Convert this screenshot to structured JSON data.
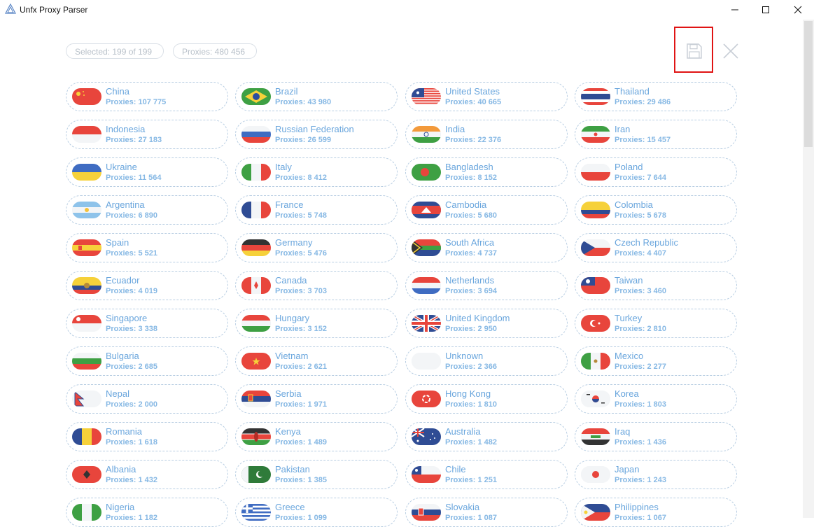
{
  "window": {
    "title": "Unfx Proxy Parser"
  },
  "toolbar": {
    "selected_text": "Selected: 199 of 199",
    "proxies_text": "Proxies: 480 456",
    "save_icon": "save-icon",
    "close_icon": "close-icon"
  },
  "countries": [
    {
      "name": "China",
      "count": "Proxies: 107 775",
      "flag": "cn"
    },
    {
      "name": "Brazil",
      "count": "Proxies: 43 980",
      "flag": "br"
    },
    {
      "name": "United States",
      "count": "Proxies: 40 665",
      "flag": "us"
    },
    {
      "name": "Thailand",
      "count": "Proxies: 29 486",
      "flag": "th"
    },
    {
      "name": "Indonesia",
      "count": "Proxies: 27 183",
      "flag": "id"
    },
    {
      "name": "Russian Federation",
      "count": "Proxies: 26 599",
      "flag": "ru"
    },
    {
      "name": "India",
      "count": "Proxies: 22 376",
      "flag": "in"
    },
    {
      "name": "Iran",
      "count": "Proxies: 15 457",
      "flag": "ir"
    },
    {
      "name": "Ukraine",
      "count": "Proxies: 11 564",
      "flag": "ua"
    },
    {
      "name": "Italy",
      "count": "Proxies: 8 412",
      "flag": "it"
    },
    {
      "name": "Bangladesh",
      "count": "Proxies: 8 152",
      "flag": "bd"
    },
    {
      "name": "Poland",
      "count": "Proxies: 7 644",
      "flag": "pl"
    },
    {
      "name": "Argentina",
      "count": "Proxies: 6 890",
      "flag": "ar"
    },
    {
      "name": "France",
      "count": "Proxies: 5 748",
      "flag": "fr"
    },
    {
      "name": "Cambodia",
      "count": "Proxies: 5 680",
      "flag": "kh"
    },
    {
      "name": "Colombia",
      "count": "Proxies: 5 678",
      "flag": "co"
    },
    {
      "name": "Spain",
      "count": "Proxies: 5 521",
      "flag": "es"
    },
    {
      "name": "Germany",
      "count": "Proxies: 5 476",
      "flag": "de"
    },
    {
      "name": "South Africa",
      "count": "Proxies: 4 737",
      "flag": "za"
    },
    {
      "name": "Czech Republic",
      "count": "Proxies: 4 407",
      "flag": "cz"
    },
    {
      "name": "Ecuador",
      "count": "Proxies: 4 019",
      "flag": "ec"
    },
    {
      "name": "Canada",
      "count": "Proxies: 3 703",
      "flag": "ca"
    },
    {
      "name": "Netherlands",
      "count": "Proxies: 3 694",
      "flag": "nl"
    },
    {
      "name": "Taiwan",
      "count": "Proxies: 3 460",
      "flag": "tw"
    },
    {
      "name": "Singapore",
      "count": "Proxies: 3 338",
      "flag": "sg"
    },
    {
      "name": "Hungary",
      "count": "Proxies: 3 152",
      "flag": "hu"
    },
    {
      "name": "United Kingdom",
      "count": "Proxies: 2 950",
      "flag": "gb"
    },
    {
      "name": "Turkey",
      "count": "Proxies: 2 810",
      "flag": "tr"
    },
    {
      "name": "Bulgaria",
      "count": "Proxies: 2 685",
      "flag": "bg"
    },
    {
      "name": "Vietnam",
      "count": "Proxies: 2 621",
      "flag": "vn"
    },
    {
      "name": "Unknown",
      "count": "Proxies: 2 366",
      "flag": "unknown"
    },
    {
      "name": "Mexico",
      "count": "Proxies: 2 277",
      "flag": "mx"
    },
    {
      "name": "Nepal",
      "count": "Proxies: 2 000",
      "flag": "np"
    },
    {
      "name": "Serbia",
      "count": "Proxies: 1 971",
      "flag": "rs"
    },
    {
      "name": "Hong Kong",
      "count": "Proxies: 1 810",
      "flag": "hk"
    },
    {
      "name": "Korea",
      "count": "Proxies: 1 803",
      "flag": "kr"
    },
    {
      "name": "Romania",
      "count": "Proxies: 1 618",
      "flag": "ro"
    },
    {
      "name": "Kenya",
      "count": "Proxies: 1 489",
      "flag": "ke"
    },
    {
      "name": "Australia",
      "count": "Proxies: 1 482",
      "flag": "au"
    },
    {
      "name": "Iraq",
      "count": "Proxies: 1 436",
      "flag": "iq"
    },
    {
      "name": "Albania",
      "count": "Proxies: 1 432",
      "flag": "al"
    },
    {
      "name": "Pakistan",
      "count": "Proxies: 1 385",
      "flag": "pk"
    },
    {
      "name": "Chile",
      "count": "Proxies: 1 251",
      "flag": "cl"
    },
    {
      "name": "Japan",
      "count": "Proxies: 1 243",
      "flag": "jp"
    },
    {
      "name": "Nigeria",
      "count": "Proxies: 1 182",
      "flag": "ng"
    },
    {
      "name": "Greece",
      "count": "Proxies: 1 099",
      "flag": "gr"
    },
    {
      "name": "Slovakia",
      "count": "Proxies: 1 087",
      "flag": "sk"
    },
    {
      "name": "Philippines",
      "count": "Proxies: 1 067",
      "flag": "ph"
    }
  ],
  "colors": {
    "accent": "#6aa6dd",
    "card_border": "#b7cde2",
    "highlight": "#e01414"
  }
}
